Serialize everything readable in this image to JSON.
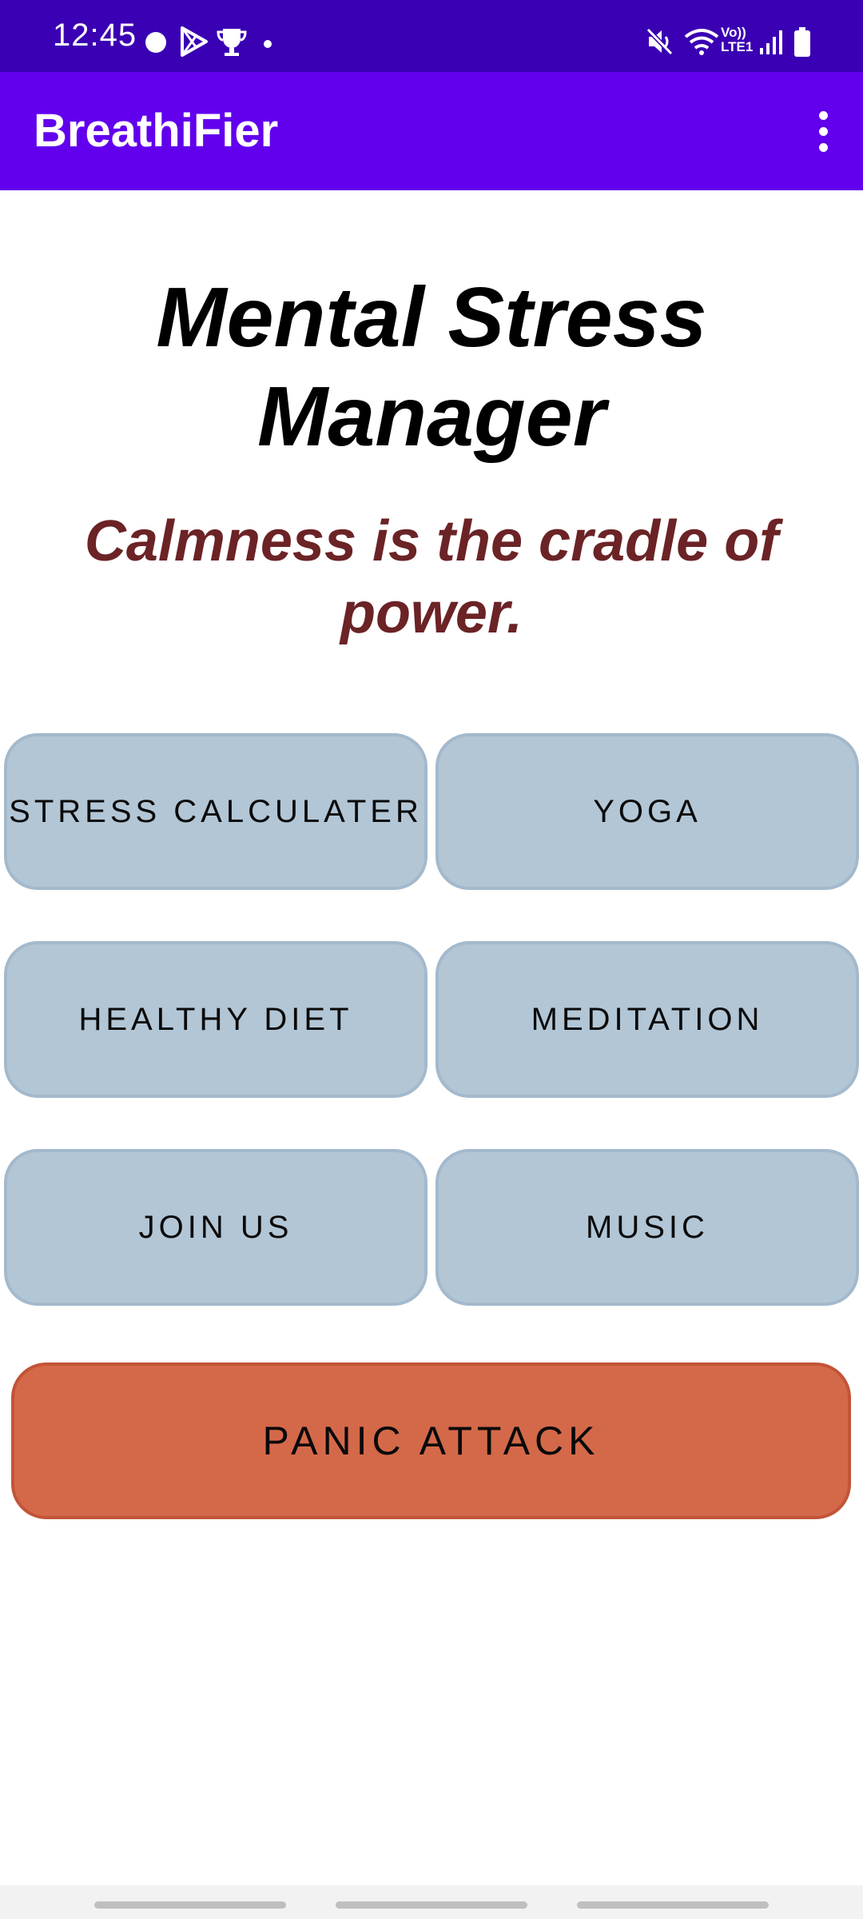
{
  "status_bar": {
    "time": "12:45",
    "network_label": "Vo)) LTE1",
    "icons": [
      "notification-dot-icon",
      "play-store-icon",
      "trophy-icon",
      "more-notifications-dot",
      "mute-icon",
      "wifi-icon",
      "signal-icon",
      "battery-icon"
    ]
  },
  "app_bar": {
    "title": "BreathiFier",
    "menu_icon": "more-vert-icon"
  },
  "main": {
    "heading": "Mental Stress Manager",
    "quote": "Calmness is the cradle of power.",
    "buttons": [
      {
        "label": "STRESS CALCULATER"
      },
      {
        "label": "YOGA"
      },
      {
        "label": "HEALTHY DIET"
      },
      {
        "label": "MEDITATION"
      },
      {
        "label": "JOIN US"
      },
      {
        "label": "MUSIC"
      }
    ],
    "panic_button": "PANIC ATTACK"
  },
  "colors": {
    "status_bar": "#3a00b3",
    "app_bar": "#6200ee",
    "quote_text": "#6b2326",
    "button_bg": "#b2c6d6",
    "panic_bg": "#d4694a"
  }
}
